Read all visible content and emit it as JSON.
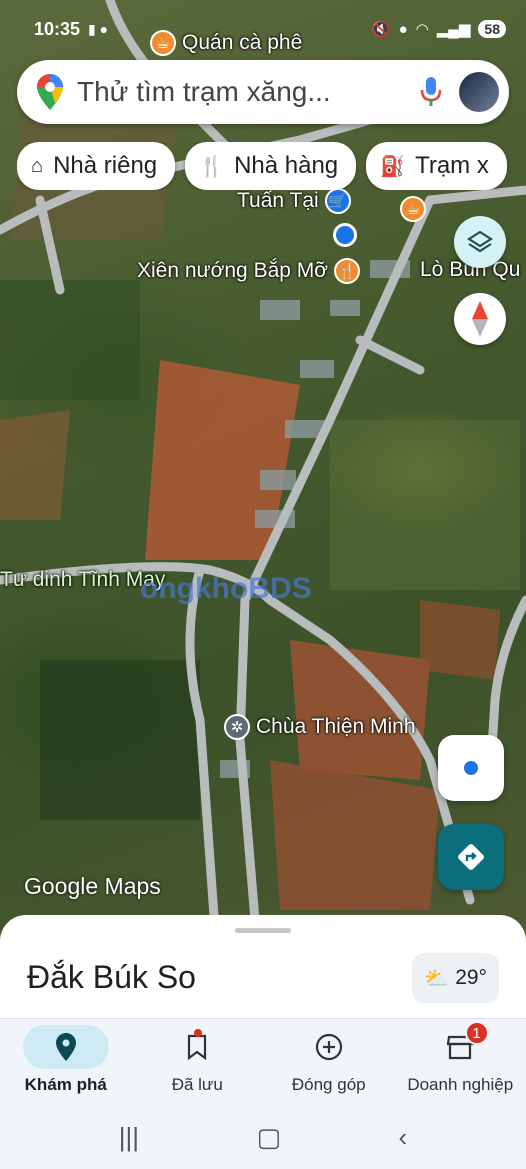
{
  "status_bar": {
    "time": "10:35",
    "battery": "58"
  },
  "search": {
    "placeholder": "Thử tìm trạm xăng..."
  },
  "chips": [
    {
      "label": "Nhà riêng",
      "icon": "home-icon"
    },
    {
      "label": "Nhà hàng",
      "icon": "restaurant-icon"
    },
    {
      "label": "Trạm x",
      "icon": "gas-station-icon"
    }
  ],
  "map": {
    "pois": [
      {
        "label": "Quán cà phê",
        "icon": "coffee-icon"
      },
      {
        "label": "Tuấn Tại",
        "icon": "shopping-cart-icon"
      },
      {
        "label": "Xiên nướng Bắp Mỡ",
        "icon": "restaurant-icon"
      },
      {
        "label": "Lò Bún Qu",
        "icon": "coffee-icon"
      },
      {
        "label": "Tư dinh Tĩnh May",
        "icon": "place-icon"
      },
      {
        "label": "Chùa Thiện Minh",
        "icon": "temple-icon"
      }
    ],
    "watermark": "ongkhoBDS",
    "logo": "Google Maps"
  },
  "sheet": {
    "place_name": "Đắk Búk So",
    "weather_temp": "29°",
    "weather_icon": "partly-cloudy-icon"
  },
  "bottom_nav": [
    {
      "label": "Khám phá",
      "icon": "explore-pin-icon",
      "active": true
    },
    {
      "label": "Đã lưu",
      "icon": "bookmark-icon",
      "active": false
    },
    {
      "label": "Đóng góp",
      "icon": "add-circle-icon",
      "active": false
    },
    {
      "label": "Doanh nghiệp",
      "icon": "store-icon",
      "active": false,
      "badge": "1"
    }
  ],
  "colors": {
    "accent": "#1a73e8",
    "directions": "#0b6e7a",
    "nav_active": "#cdeaf5"
  }
}
